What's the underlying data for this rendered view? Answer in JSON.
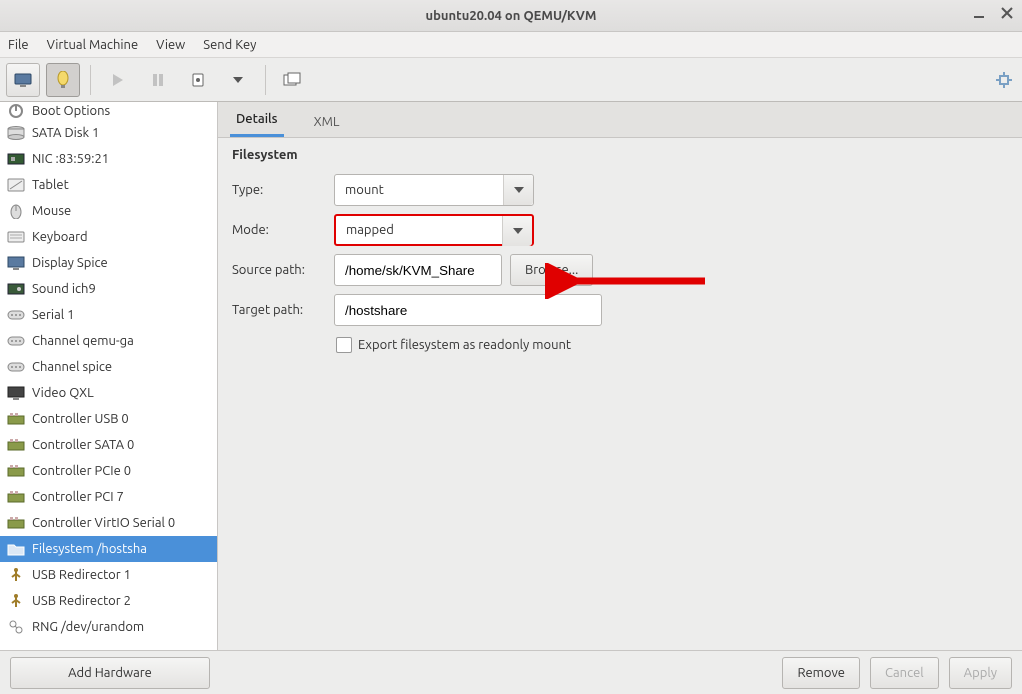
{
  "window": {
    "title": "ubuntu20.04 on QEMU/KVM"
  },
  "menu": {
    "file": "File",
    "vm": "Virtual Machine",
    "view": "View",
    "send_key": "Send Key"
  },
  "sidebar": {
    "items": [
      {
        "label": "Boot Options",
        "icon": "boot-icon"
      },
      {
        "label": "SATA Disk 1",
        "icon": "disk-icon"
      },
      {
        "label": "NIC :83:59:21",
        "icon": "nic-icon"
      },
      {
        "label": "Tablet",
        "icon": "tablet-icon"
      },
      {
        "label": "Mouse",
        "icon": "mouse-icon"
      },
      {
        "label": "Keyboard",
        "icon": "keyboard-icon"
      },
      {
        "label": "Display Spice",
        "icon": "display-icon"
      },
      {
        "label": "Sound ich9",
        "icon": "sound-icon"
      },
      {
        "label": "Serial 1",
        "icon": "serial-icon"
      },
      {
        "label": "Channel qemu-ga",
        "icon": "channel-icon"
      },
      {
        "label": "Channel spice",
        "icon": "channel-icon"
      },
      {
        "label": "Video QXL",
        "icon": "video-icon"
      },
      {
        "label": "Controller USB 0",
        "icon": "controller-icon"
      },
      {
        "label": "Controller SATA 0",
        "icon": "controller-icon"
      },
      {
        "label": "Controller PCIe 0",
        "icon": "controller-icon"
      },
      {
        "label": "Controller PCI 7",
        "icon": "controller-icon"
      },
      {
        "label": "Controller VirtIO Serial 0",
        "icon": "controller-icon"
      },
      {
        "label": "Filesystem /hostsha",
        "icon": "folder-icon",
        "selected": true
      },
      {
        "label": "USB Redirector 1",
        "icon": "usb-icon"
      },
      {
        "label": "USB Redirector 2",
        "icon": "usb-icon"
      },
      {
        "label": "RNG /dev/urandom",
        "icon": "rng-icon"
      }
    ]
  },
  "tabs": {
    "details": "Details",
    "xml": "XML"
  },
  "section_title": "Filesystem",
  "form": {
    "type_label": "Type:",
    "type_value": "mount",
    "mode_label": "Mode:",
    "mode_value": "mapped",
    "source_label": "Source path:",
    "source_value": "/home/sk/KVM_Share",
    "browse_label": "Browse...",
    "target_label": "Target path:",
    "target_value": "/hostshare",
    "export_label": "Export filesystem as readonly mount"
  },
  "footer": {
    "add_hw": "Add Hardware",
    "remove": "Remove",
    "cancel": "Cancel",
    "apply": "Apply"
  }
}
